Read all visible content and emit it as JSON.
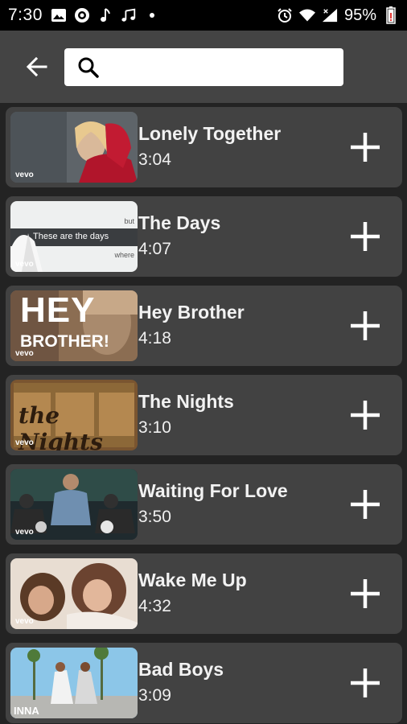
{
  "status_bar": {
    "time": "7:30",
    "battery": "95%",
    "icons_left": [
      "image-icon",
      "location-icon",
      "music-note-icon",
      "music-notes-icon",
      "dot-icon"
    ],
    "icons_right": [
      "alarm-icon",
      "wifi-icon",
      "cell-signal-icon",
      "battery-icon"
    ]
  },
  "search": {
    "placeholder": "",
    "value": ""
  },
  "songs": [
    {
      "title": "Lonely Together",
      "duration": "3:04",
      "badge": "vevo"
    },
    {
      "title": "The Days",
      "duration": "4:07",
      "badge": "vevo",
      "thumb_text": "These are the days",
      "thumb_text2": "but",
      "thumb_text3": "where"
    },
    {
      "title": "Hey Brother",
      "duration": "4:18",
      "badge": "vevo",
      "thumb_text": "HEY",
      "thumb_text2": "BROTHER!"
    },
    {
      "title": "The Nights",
      "duration": "3:10",
      "badge": "vevo",
      "thumb_text": "the Nights"
    },
    {
      "title": "Waiting For Love",
      "duration": "3:50",
      "badge": "vevo"
    },
    {
      "title": "Wake Me Up",
      "duration": "4:32",
      "badge": "vevo"
    },
    {
      "title": "Bad Boys",
      "duration": "3:09",
      "badge": "INNA"
    }
  ],
  "colors": {
    "background": "#232323",
    "card": "#424242",
    "app_bar": "#444444",
    "status_bar": "#000000",
    "battery_low": "#e53935"
  }
}
